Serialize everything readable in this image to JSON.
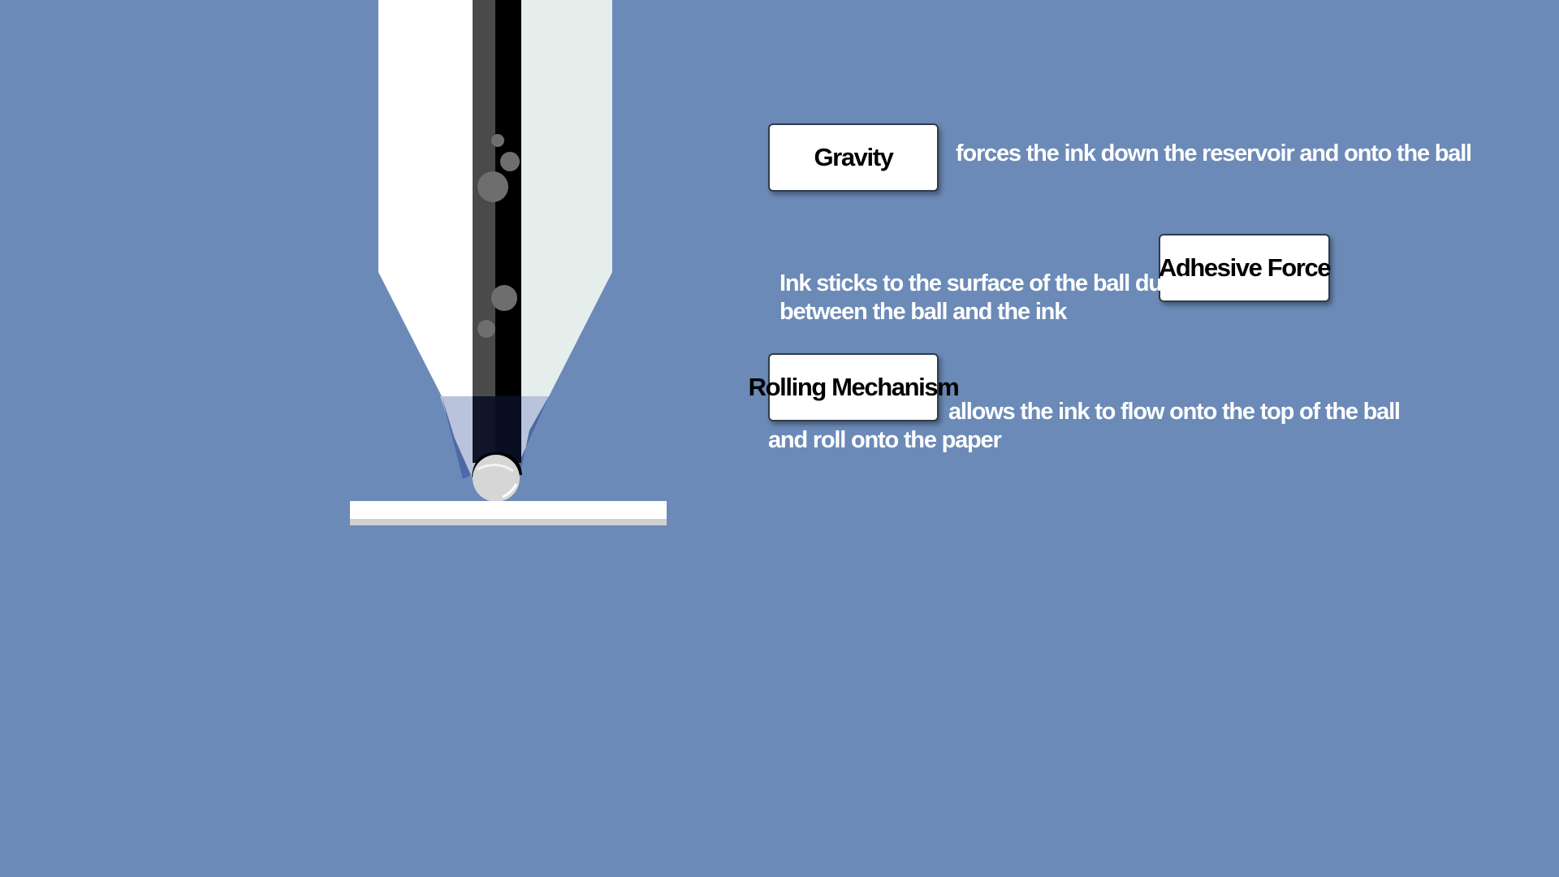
{
  "colors": {
    "background": "#6b8ab7",
    "ink": "#000000",
    "pen_body": "#ffffff",
    "paper": "#ffffff"
  },
  "labels": {
    "gravity": "Gravity",
    "adhesive": "Adhesive Force",
    "rolling": "Rolling Mechanism"
  },
  "descriptions": {
    "gravity": "forces the ink down the reservoir and onto the ball",
    "adhesive_line1": "Ink sticks to the surface of the ball due to",
    "adhesive_line2": "between the ball and the ink",
    "rolling_line1": "allows the ink to flow onto the top of the ball",
    "rolling_line2": "and roll onto the paper"
  }
}
